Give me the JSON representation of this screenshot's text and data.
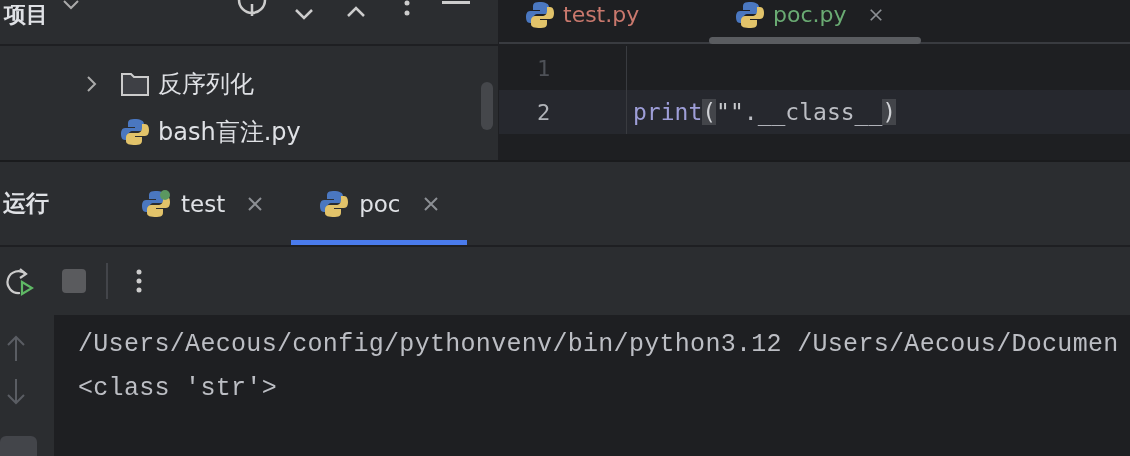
{
  "project_panel": {
    "title": "项目",
    "tree": [
      {
        "kind": "folder",
        "label": "反序列化",
        "expanded": false
      },
      {
        "kind": "python",
        "label": "bash盲注.py"
      }
    ]
  },
  "editor": {
    "tabs": [
      {
        "label": "test.py",
        "selected": false,
        "color": "#c9786d"
      },
      {
        "label": "poc.py",
        "selected": true,
        "color": "#6aab73"
      }
    ],
    "lines": [
      {
        "number": "1",
        "current": false
      },
      {
        "number": "2",
        "current": true,
        "tokens": [
          {
            "kind": "function",
            "text": "print"
          },
          {
            "kind": "bracket",
            "text": "("
          },
          {
            "kind": "string",
            "text": "\"\""
          },
          {
            "kind": "plain",
            "text": ".__class__"
          },
          {
            "kind": "bracket",
            "text": ")"
          }
        ]
      }
    ]
  },
  "run_panel": {
    "title": "运行",
    "tabs": [
      {
        "label": "test",
        "selected": false,
        "running": true
      },
      {
        "label": "poc",
        "selected": true,
        "running": false
      }
    ],
    "console": [
      "/Users/Aecous/config/pythonvenv/bin/python3.12 /Users/Aecous/Documen",
      "<class 'str'>"
    ]
  }
}
